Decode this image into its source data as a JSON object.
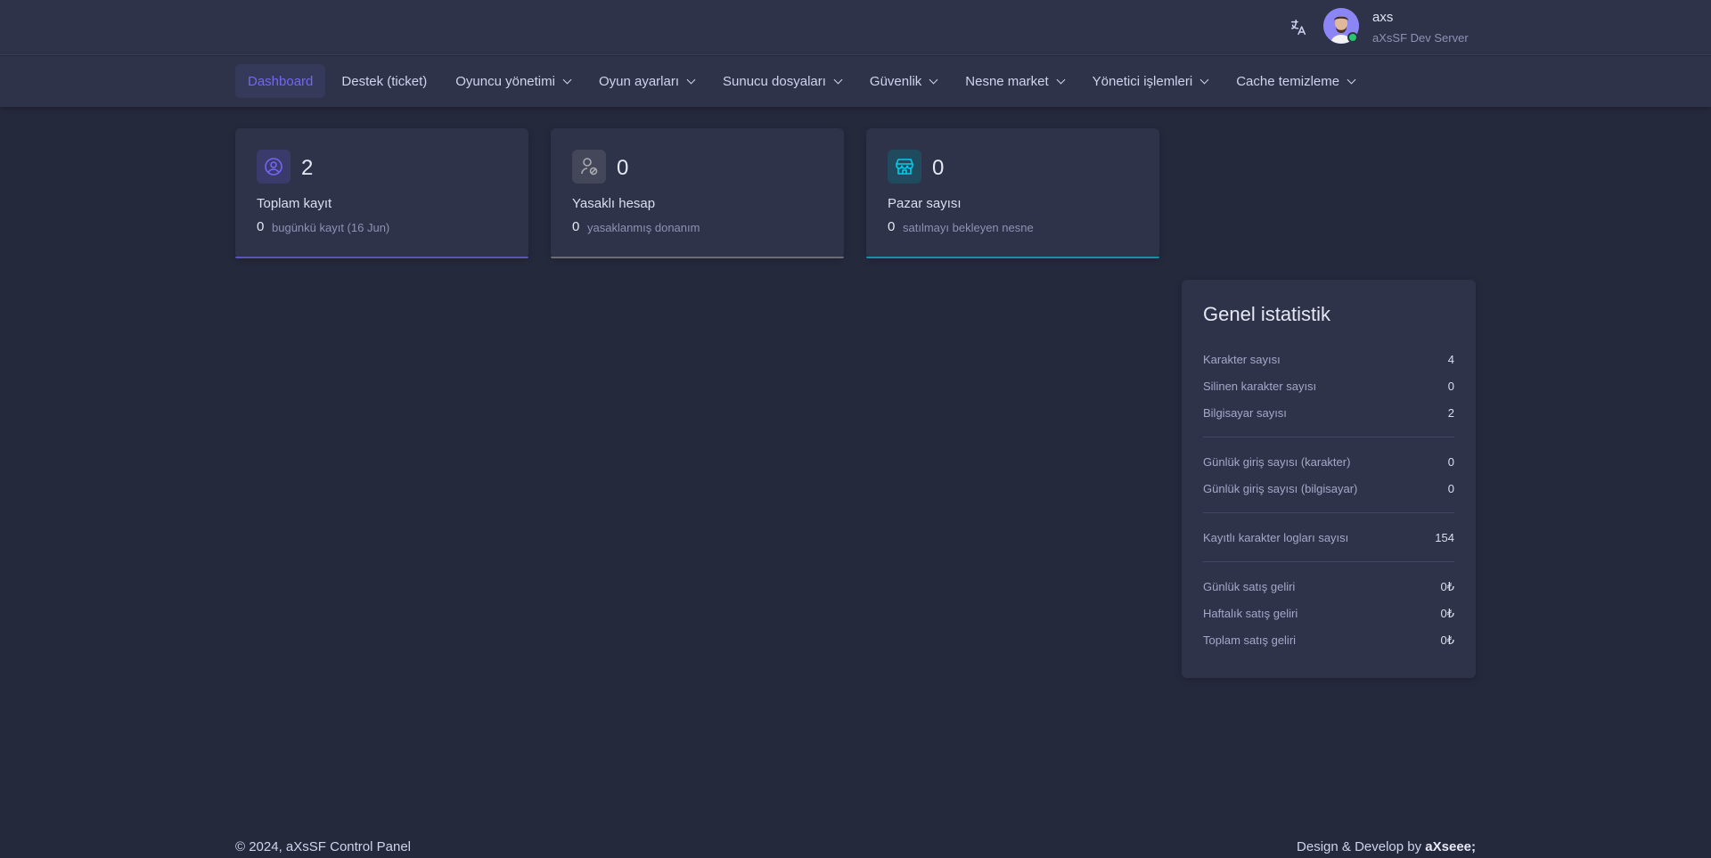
{
  "header": {
    "user_name": "axs",
    "user_server": "aXsSF Dev Server",
    "language_icon": "translate-icon",
    "online_color": "#28c76f"
  },
  "nav": {
    "items": [
      {
        "label": "Dashboard",
        "active": true,
        "dropdown": false
      },
      {
        "label": "Destek (ticket)",
        "dropdown": false
      },
      {
        "label": "Oyuncu yönetimi",
        "dropdown": true
      },
      {
        "label": "Oyun ayarları",
        "dropdown": true
      },
      {
        "label": "Sunucu dosyaları",
        "dropdown": true
      },
      {
        "label": "Güvenlik",
        "dropdown": true
      },
      {
        "label": "Nesne market",
        "dropdown": true
      },
      {
        "label": "Yönetici işlemleri",
        "dropdown": true
      },
      {
        "label": "Cache temizleme",
        "dropdown": true
      }
    ],
    "accent": "#7367f0"
  },
  "cards": [
    {
      "value": "2",
      "title": "Toplam kayıt",
      "sub_value": "0",
      "sub_text": "bugünkü kayıt (16 Jun)",
      "icon": "user-circle-icon",
      "color": "#7367f0"
    },
    {
      "value": "0",
      "title": "Yasaklı hesap",
      "sub_value": "0",
      "sub_text": "yasaklanmış donanım",
      "icon": "user-banned-icon",
      "color": "#a8aaae"
    },
    {
      "value": "0",
      "title": "Pazar sayısı",
      "sub_value": "0",
      "sub_text": "satılmayı bekleyen nesne",
      "icon": "store-icon",
      "color": "#00cfe8"
    }
  ],
  "stats": {
    "title": "Genel istatistik",
    "rows": [
      {
        "label": "Karakter sayısı",
        "value": "4"
      },
      {
        "label": "Silinen karakter sayısı",
        "value": "0"
      },
      {
        "label": "Bilgisayar sayısı",
        "value": "2"
      },
      {
        "label": "Günlük giriş sayısı (karakter)",
        "value": "0"
      },
      {
        "label": "Günlük giriş sayısı (bilgisayar)",
        "value": "0"
      },
      {
        "label": "Kayıtlı karakter logları sayısı",
        "value": "154"
      },
      {
        "label": "Günlük satış geliri",
        "value": "0₺"
      },
      {
        "label": "Haftalık satış geliri",
        "value": "0₺"
      },
      {
        "label": "Toplam satış geliri",
        "value": "0₺"
      }
    ]
  },
  "footer": {
    "copyright": "© 2024, aXsSF Control Panel",
    "credit_prefix": "Design & Develop by ",
    "credit_brand": "aXseee;"
  }
}
